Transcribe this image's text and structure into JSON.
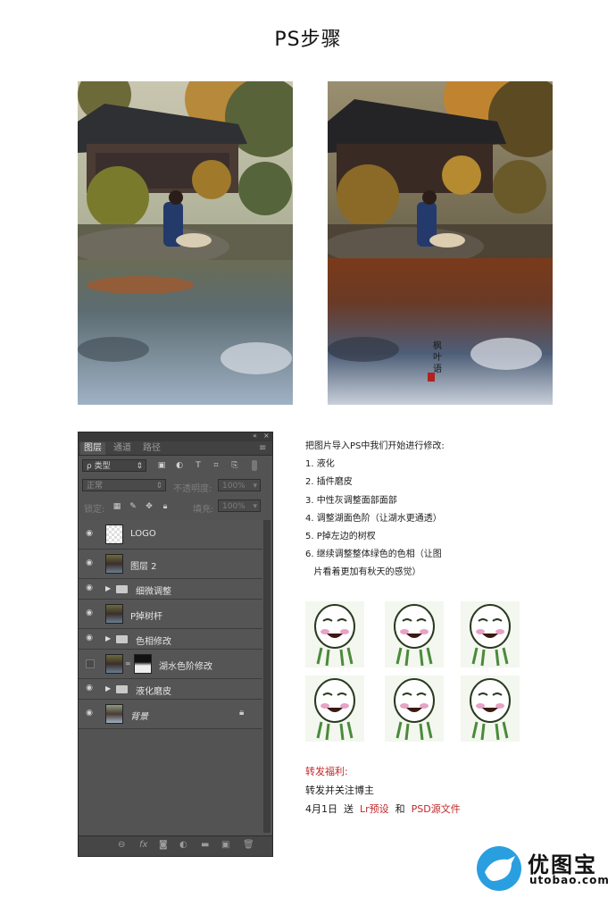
{
  "title": "PS步骤",
  "after_photo": {
    "seal_chars": [
      "枫",
      "叶",
      "语"
    ]
  },
  "ps_panel": {
    "tabs": [
      "图层",
      "通道",
      "路径"
    ],
    "kind_filter": "ρ 类型",
    "blend_mode": "正常",
    "opacity_label": "不透明度:",
    "opacity_value": "100%",
    "lock_label": "锁定:",
    "fill_label": "填充:",
    "fill_value": "100%",
    "layers": [
      {
        "name": "LOGO",
        "type": "transparent",
        "visible": true
      },
      {
        "name": "图层 2",
        "type": "image",
        "visible": true
      },
      {
        "name": "细微调整",
        "type": "group",
        "visible": true
      },
      {
        "name": "P掉树杆",
        "type": "image",
        "visible": true
      },
      {
        "name": "色相修改",
        "type": "group",
        "visible": true
      },
      {
        "name": "湖水色阶修改",
        "type": "adjustment",
        "visible": false
      },
      {
        "name": "液化磨皮",
        "type": "group",
        "visible": true
      },
      {
        "name": "背景",
        "type": "image",
        "visible": true,
        "locked": true
      }
    ],
    "bottom_icons": [
      "link-icon",
      "fx-icon",
      "mask-icon",
      "adjustment-icon",
      "folder-icon",
      "new-layer-icon",
      "trash-icon"
    ]
  },
  "instructions": {
    "intro": "把图片导入PS中我们开始进行修改:",
    "steps": [
      "1. 液化",
      "2. 插件磨皮",
      "3. 中性灰调整面部面部",
      "4. 调整湖面色阶（让湖水更通透）",
      "5. P掉左边的树杈",
      "6. 继续调整整体绿色的色相（让图",
      "   片看着更加有秋天的感觉）"
    ]
  },
  "bonus": {
    "heading": "转发福利:",
    "line1": "转发并关注博主",
    "line2_prefix": "4月1日  送  ",
    "lr": "Lr预设",
    "and": "  和  ",
    "psd": "PSD源文件"
  },
  "brand": {
    "name": "优图宝",
    "domain": "utobao.com"
  },
  "colors": {
    "panel_bg": "#535353",
    "accent_red": "#c0282a",
    "brand_blue": "#2a9fe0"
  }
}
